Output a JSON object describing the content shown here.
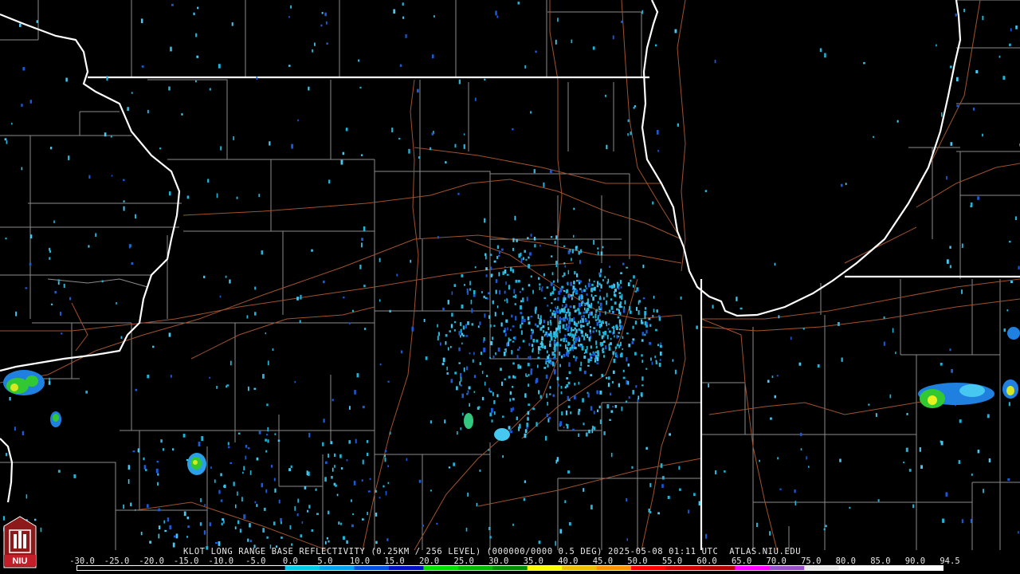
{
  "product": {
    "caption": "KLOT LONG RANGE BASE REFLECTIVITY (0.25KM / 256 LEVEL) (000000/0000 0.5 DEG) 2025-05-08 01:11 UTC  ATLAS.NIU.EDU"
  },
  "logo": {
    "text": "NIU"
  },
  "color_scale": {
    "labels": [
      "-30.0",
      "-25.0",
      "-20.0",
      "-15.0",
      "-10.0",
      "-5.0",
      "0.0",
      "5.0",
      "10.0",
      "15.0",
      "20.0",
      "25.0",
      "30.0",
      "35.0",
      "40.0",
      "45.0",
      "50.0",
      "55.0",
      "60.0",
      "65.0",
      "70.0",
      "75.0",
      "80.0",
      "85.0",
      "90.0",
      "94.5"
    ],
    "colors": [
      "#000000",
      "#000000",
      "#000000",
      "#000000",
      "#000000",
      "#000000",
      "#00c8e6",
      "#00a0f0",
      "#0050e0",
      "#0010c0",
      "#00e000",
      "#00b800",
      "#008c00",
      "#fcfc00",
      "#e8c000",
      "#fc9000",
      "#fc0000",
      "#d00000",
      "#b00000",
      "#fc00fc",
      "#9850c8",
      "#e8e8e8",
      "#ffffff",
      "#ffffff",
      "#ffffff"
    ]
  },
  "colors": {
    "state_border": "#ffffff",
    "county_border": "#8c8c8c",
    "highway": "#a0522d",
    "echo_weak": "#20b4d8",
    "echo_light": "#46c8f0",
    "echo_mod": "#1a5adc",
    "echo_green": "#32c832",
    "echo_yellow": "#f0f000",
    "background": "#000000"
  }
}
